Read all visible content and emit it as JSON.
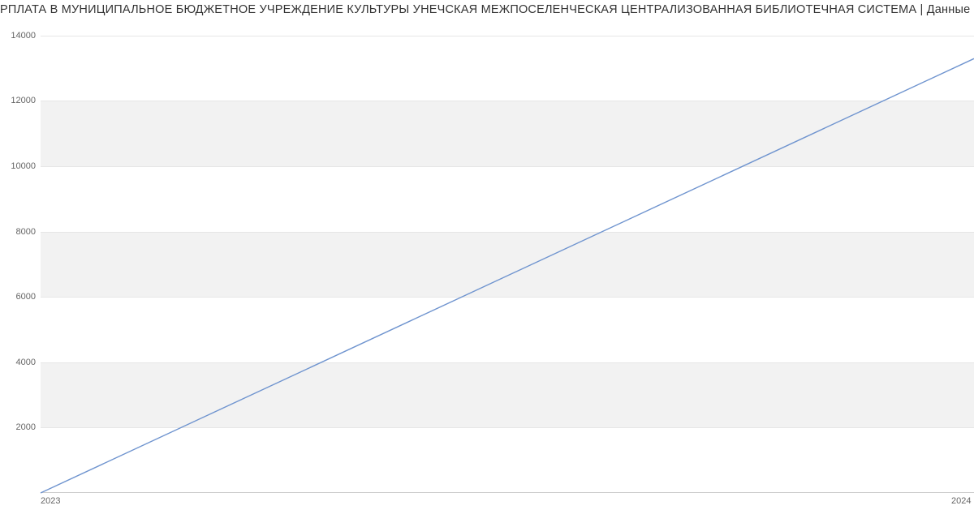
{
  "chart_data": {
    "type": "line",
    "title": "РПЛАТА В МУНИЦИПАЛЬНОЕ БЮДЖЕТНОЕ УЧРЕЖДЕНИЕ КУЛЬТУРЫ УНЕЧСКАЯ МЕЖПОСЕЛЕНЧЕСКАЯ ЦЕНТРАЛИЗОВАННАЯ БИБЛИОТЕЧНАЯ СИСТЕМА | Данные mnogo.wo",
    "x": [
      2023,
      2024
    ],
    "values": [
      0,
      13300
    ],
    "x_tick_labels": [
      "2023",
      "2024"
    ],
    "y_tick_labels": [
      "2000",
      "4000",
      "6000",
      "8000",
      "10000",
      "12000",
      "14000"
    ],
    "xlim": [
      2023,
      2024
    ],
    "ylim": [
      0,
      14400
    ],
    "line_color": "#6f94cf",
    "band_color": "#f2f2f2",
    "grid": true
  }
}
